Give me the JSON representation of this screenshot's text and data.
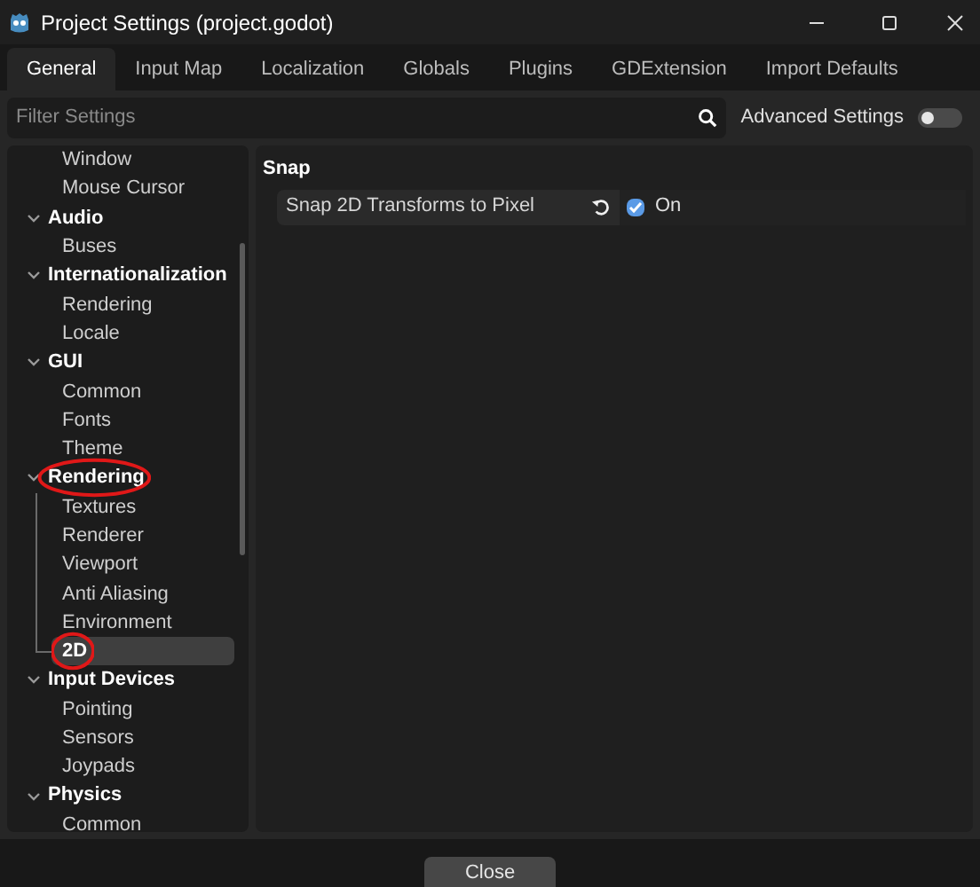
{
  "window": {
    "title": "Project Settings (project.godot)"
  },
  "tabs": [
    {
      "label": "General",
      "selected": true
    },
    {
      "label": "Input Map",
      "selected": false
    },
    {
      "label": "Localization",
      "selected": false
    },
    {
      "label": "Globals",
      "selected": false
    },
    {
      "label": "Plugins",
      "selected": false
    },
    {
      "label": "GDExtension",
      "selected": false
    },
    {
      "label": "Import Defaults",
      "selected": false
    }
  ],
  "filter": {
    "placeholder": "Filter Settings"
  },
  "advanced_settings": {
    "label": "Advanced Settings",
    "on": false
  },
  "tree": [
    {
      "label": "Window",
      "selected": false,
      "circled": false
    },
    {
      "label": "Mouse Cursor",
      "selected": false,
      "circled": false
    },
    {
      "label": "Audio",
      "expanded": true,
      "circled": false,
      "children": [
        {
          "label": "Buses",
          "selected": false,
          "circled": false
        }
      ]
    },
    {
      "label": "Internationalization",
      "expanded": true,
      "circled": false,
      "children": [
        {
          "label": "Rendering",
          "selected": false,
          "circled": false
        },
        {
          "label": "Locale",
          "selected": false,
          "circled": false
        }
      ]
    },
    {
      "label": "GUI",
      "expanded": true,
      "circled": false,
      "children": [
        {
          "label": "Common",
          "selected": false,
          "circled": false
        },
        {
          "label": "Fonts",
          "selected": false,
          "circled": false
        },
        {
          "label": "Theme",
          "selected": false,
          "circled": false
        }
      ]
    },
    {
      "label": "Rendering",
      "expanded": true,
      "circled": true,
      "children": [
        {
          "label": "Textures",
          "selected": false,
          "circled": false
        },
        {
          "label": "Renderer",
          "selected": false,
          "circled": false
        },
        {
          "label": "Viewport",
          "selected": false,
          "circled": false
        },
        {
          "label": "Anti Aliasing",
          "selected": false,
          "circled": false
        },
        {
          "label": "Environment",
          "selected": false,
          "circled": false
        },
        {
          "label": "2D",
          "selected": true,
          "circled": true
        }
      ]
    },
    {
      "label": "Input Devices",
      "expanded": true,
      "circled": false,
      "children": [
        {
          "label": "Pointing",
          "selected": false,
          "circled": false
        },
        {
          "label": "Sensors",
          "selected": false,
          "circled": false
        },
        {
          "label": "Joypads",
          "selected": false,
          "circled": false
        }
      ]
    },
    {
      "label": "Physics",
      "expanded": true,
      "circled": false,
      "children": [
        {
          "label": "Common",
          "selected": false,
          "circled": false
        }
      ]
    }
  ],
  "section": {
    "title": "Snap",
    "properties": [
      {
        "label": "Snap 2D Transforms to Pixel",
        "checked": true,
        "value": "On"
      }
    ]
  },
  "buttons": [
    {
      "label": "Close"
    }
  ]
}
